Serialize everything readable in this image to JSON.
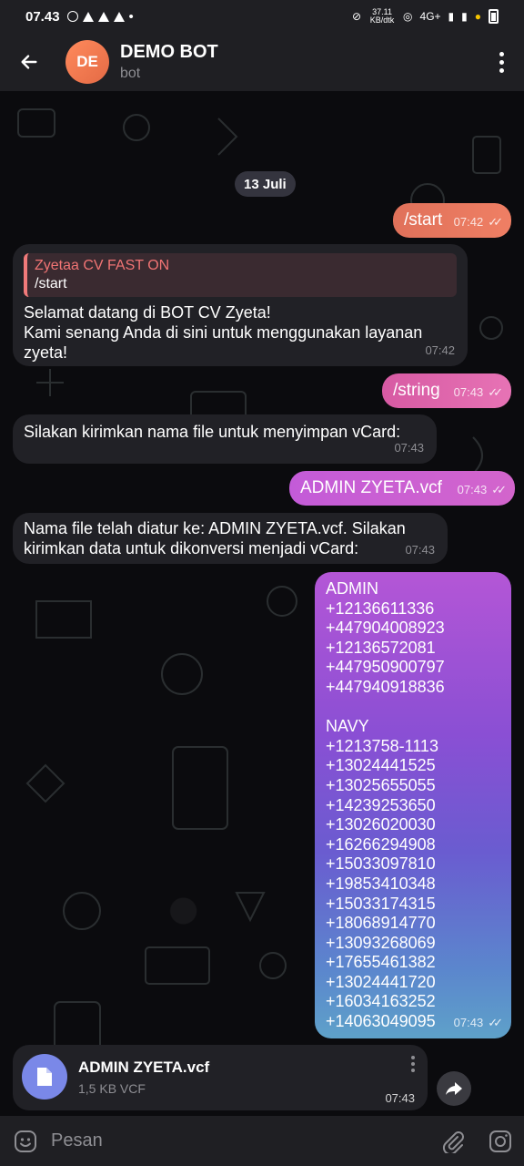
{
  "status_bar": {
    "time": "07.43",
    "net_speed": "37.11 KB/dtk",
    "network": "4G+"
  },
  "header": {
    "avatar_initials": "DE",
    "title": "DEMO BOT",
    "subtitle": "bot"
  },
  "chat": {
    "date": "13 Juli",
    "messages": [
      {
        "text": "/start",
        "time": "07:42"
      },
      {
        "reply_author": "Zyetaa CV FAST ON",
        "reply_text": "/start",
        "line1": "Selamat datang di BOT CV Zyeta!",
        "line2": "Kami senang Anda di sini untuk menggunakan layanan",
        "line3": "zyeta!",
        "time": "07:42"
      },
      {
        "text": "/string",
        "time": "07:43"
      },
      {
        "text": "Silakan kirimkan nama file untuk menyimpan vCard:",
        "time": "07:43"
      },
      {
        "text": "ADMIN ZYETA.vcf",
        "time": "07:43"
      },
      {
        "line1": "Nama file telah diatur ke: ADMIN ZYETA.vcf. Silakan",
        "line2": "kirimkan data untuk dikonversi menjadi vCard:",
        "time": "07:43"
      },
      {
        "lines": [
          "ADMIN",
          "+12136611336",
          "+447904008923",
          "+12136572081",
          "+447950900797",
          "+447940918836",
          "",
          "NAVY",
          "+1213758-1113",
          "+13024441525",
          "+13025655055",
          "+14239253650",
          "+13026020030",
          "+16266294908",
          "+15033097810",
          "+19853410348",
          "+15033174315",
          "+18068914770",
          "+13093268069",
          "+17655461382",
          "+13024441720",
          "+16034163252",
          "+14063049095"
        ],
        "time": "07:43"
      }
    ],
    "file": {
      "name": "ADMIN ZYETA.vcf",
      "size": "1,5 KB VCF",
      "time": "07:43"
    }
  },
  "input": {
    "placeholder": "Pesan"
  }
}
